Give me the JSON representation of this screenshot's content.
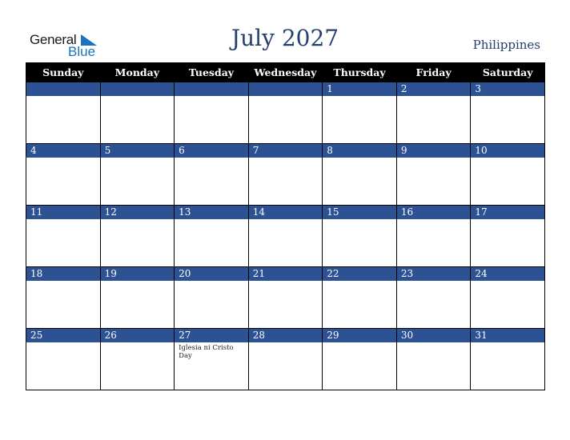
{
  "logo": {
    "general": "General",
    "blue": "Blue"
  },
  "title": "July 2027",
  "country": "Philippines",
  "weekdays": [
    "Sunday",
    "Monday",
    "Tuesday",
    "Wednesday",
    "Thursday",
    "Friday",
    "Saturday"
  ],
  "weeks": [
    [
      {
        "day": "",
        "event": ""
      },
      {
        "day": "",
        "event": ""
      },
      {
        "day": "",
        "event": ""
      },
      {
        "day": "",
        "event": ""
      },
      {
        "day": "1",
        "event": ""
      },
      {
        "day": "2",
        "event": ""
      },
      {
        "day": "3",
        "event": ""
      }
    ],
    [
      {
        "day": "4",
        "event": ""
      },
      {
        "day": "5",
        "event": ""
      },
      {
        "day": "6",
        "event": ""
      },
      {
        "day": "7",
        "event": ""
      },
      {
        "day": "8",
        "event": ""
      },
      {
        "day": "9",
        "event": ""
      },
      {
        "day": "10",
        "event": ""
      }
    ],
    [
      {
        "day": "11",
        "event": ""
      },
      {
        "day": "12",
        "event": ""
      },
      {
        "day": "13",
        "event": ""
      },
      {
        "day": "14",
        "event": ""
      },
      {
        "day": "15",
        "event": ""
      },
      {
        "day": "16",
        "event": ""
      },
      {
        "day": "17",
        "event": ""
      }
    ],
    [
      {
        "day": "18",
        "event": ""
      },
      {
        "day": "19",
        "event": ""
      },
      {
        "day": "20",
        "event": ""
      },
      {
        "day": "21",
        "event": ""
      },
      {
        "day": "22",
        "event": ""
      },
      {
        "day": "23",
        "event": ""
      },
      {
        "day": "24",
        "event": ""
      }
    ],
    [
      {
        "day": "25",
        "event": ""
      },
      {
        "day": "26",
        "event": ""
      },
      {
        "day": "27",
        "event": "Iglesia ni Cristo Day"
      },
      {
        "day": "28",
        "event": ""
      },
      {
        "day": "29",
        "event": ""
      },
      {
        "day": "30",
        "event": ""
      },
      {
        "day": "31",
        "event": ""
      }
    ]
  ],
  "colors": {
    "band": "#2d5294",
    "header": "#000000",
    "title": "#243f6e",
    "logo_blue": "#1a74c0"
  }
}
